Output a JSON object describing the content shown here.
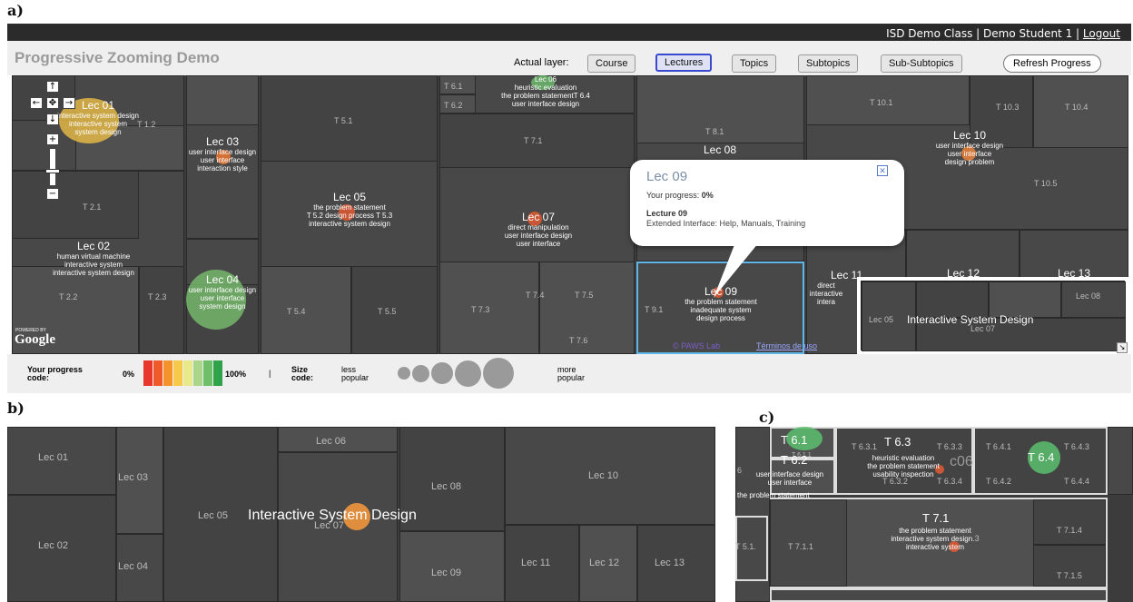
{
  "panel_labels": {
    "a": "a)",
    "b": "b)",
    "c": "c)"
  },
  "topbar": {
    "class_name": "ISD Demo Class",
    "sep": "|",
    "student": "Demo Student 1",
    "logout": "Logout"
  },
  "app_title": "Progressive Zooming Demo",
  "layers": {
    "label": "Actual layer:",
    "course": "Course",
    "lectures": "Lectures",
    "topics": "Topics",
    "subtopics": "Subtopics",
    "subsubtopics": "Sub-Subtopics",
    "active": "Lectures"
  },
  "refresh": "Refresh Progress",
  "nav_icons": {
    "up": "↑",
    "down": "↓",
    "left": "←",
    "right": "→",
    "center": "✥",
    "plus": "+",
    "minus": "−"
  },
  "powered": {
    "line1": "POWERED BY",
    "brand": "Google"
  },
  "map_footer": {
    "pawslab": "© PAWS Lab",
    "terms": "Términos de uso",
    "expand": "↘"
  },
  "treemap_a": {
    "lec01": {
      "title": "Lec 01",
      "l1": "interactive system design",
      "l2": "interactive system",
      "l3": "system design",
      "sub": "T 1.2"
    },
    "lec02": {
      "title": "Lec 02",
      "l1": "human virtual machine",
      "l2": "interactive system",
      "l3": "interactive system design"
    },
    "lec03": {
      "title": "Lec 03",
      "l1": "user interface design",
      "l2": "user interface",
      "l3": "interaction style"
    },
    "lec04": {
      "title": "Lec 04",
      "l1": "user interface design",
      "l2": "user interface",
      "l3": "system design"
    },
    "lec05": {
      "title": "Lec 05",
      "l1": "the problem statement",
      "l2": "design process",
      "l3": "interactive system design",
      "t1": "T 5.2",
      "t2": "T 5.3"
    },
    "lec06": {
      "title": "Lec 06",
      "l1": "heuristic evaluation",
      "l2": "the problem statement",
      "l3": "user interface design",
      "t": "T 6.4"
    },
    "lec07": {
      "title": "Lec 07",
      "l1": "direct manipulation",
      "l2": "user interface design",
      "l3": "user interface"
    },
    "lec08": {
      "title": "Lec 08"
    },
    "lec09": {
      "title": "Lec 09",
      "l1": "the problem statement",
      "l2": "inadequate system",
      "l3": "design process",
      "t": "T 9.1"
    },
    "lec10": {
      "title": "Lec 10",
      "l1": "user interface design",
      "l2": "user interface",
      "l3": "design problem"
    },
    "lec11": {
      "title": "Lec 11",
      "l1": "direct",
      "l2": "interactive",
      "l3": "intera"
    },
    "lec12": {
      "title": "Lec 12"
    },
    "lec13": {
      "title": "Lec 13"
    },
    "topics": {
      "t21": "T 2.1",
      "t22": "T 2.2",
      "t23": "T 2.3",
      "t51": "T 5.1",
      "t54": "T 5.4",
      "t55": "T 5.5",
      "t61": "T 6.1",
      "t62": "T 6.2",
      "t71": "T 7.1",
      "t73": "T 7.3",
      "t74": "T 7.4",
      "t75": "T 7.5",
      "t76": "T 7.6",
      "t81": "T 8.1",
      "t101": "T 10.1",
      "t103": "T 10.3",
      "t104": "T 10.4",
      "t105": "T 10.5"
    }
  },
  "popup": {
    "title": "Lec 09",
    "progress_label": "Your progress:",
    "progress_value": "0%",
    "lecture": "Lecture 09",
    "desc": "Extended Interface: Help, Manuals, Training",
    "close": "✕"
  },
  "overview": {
    "title": "Interactive System Design",
    "lec05": "Lec 05",
    "lec07": "Lec 07",
    "lec08": "Lec 08"
  },
  "legend": {
    "progress_label": "Your progress code:",
    "zero": "0%",
    "hundred": "100%",
    "sep": "|",
    "size_label": "Size code:",
    "less": "less popular",
    "more": "more popular",
    "progress_colors": [
      "#e8372b",
      "#f05a2a",
      "#f4922c",
      "#f7c94a",
      "#e7e98a",
      "#a9d68a",
      "#6fbf6a",
      "#2fa24a"
    ],
    "size_levels": 5
  },
  "panel_b": {
    "title": "Interactive System Design",
    "lec01": "Lec 01",
    "lec02": "Lec 02",
    "lec03": "Lec 03",
    "lec04": "Lec 04",
    "lec05": "Lec 05",
    "lec06": "Lec 06",
    "lec07": "Lec 07",
    "lec08": "Lec 08",
    "lec09": "Lec 09",
    "lec10": "Lec 10",
    "lec11": "Lec 11",
    "lec12": "Lec 12",
    "lec13": "Lec 13"
  },
  "panel_c": {
    "t61": "T 6.1",
    "t62": "T 6.2",
    "t63": "T 6.3",
    "t64": "T 6.4",
    "t631": "T 6.3.1",
    "t633": "T 6.3.3",
    "t632": "T 6.3.2",
    "t634": "T 6.3.4",
    "t641": "T 6.4.1",
    "t643": "T 6.4.3",
    "t642": "T 6.4.2",
    "t644": "T 6.4.4",
    "t611": "T 6.1.1",
    "he": "heuristic evaluation",
    "ps": "the problem statement",
    "ui": "usability inspection",
    "uid": "user interface design",
    "uinf": "user interface",
    "ps2": "the problem statement",
    "six": "6",
    "c06": "c06",
    "t71": "T 7.1",
    "t711": "T 7.1.1",
    "t714": "T 7.1.4",
    "t715": "T 7.1.5",
    "t713": ".3",
    "t51": "T 5.1.",
    "l1": "the problem statement",
    "l2": "interactive system design",
    "l3": "interactive system"
  }
}
